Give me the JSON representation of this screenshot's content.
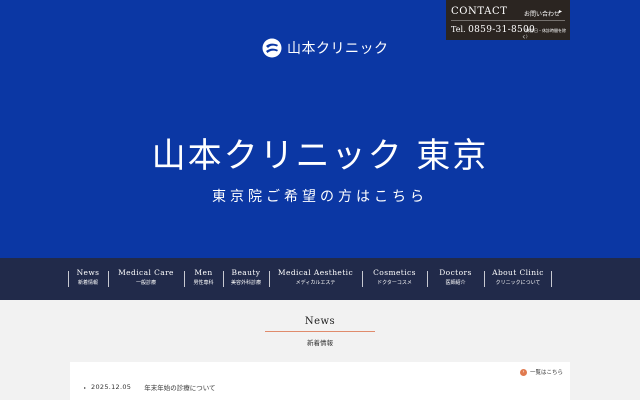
{
  "header": {
    "logo_text": "山本クリニック",
    "logo_icon": "clinic-logo-mark"
  },
  "hero": {
    "title": "山本クリニック 東京",
    "subtitle": "東京院ご希望の方はこちら"
  },
  "contact": {
    "label": "CONTACT",
    "inquiry": "お問い合わせ",
    "arrow": "▸",
    "tel_prefix": "Tel.",
    "tel_number": "0859-31-8500",
    "note": "（休診日・休診時間を除く）"
  },
  "nav": {
    "items": [
      {
        "en": "News",
        "jp": "新着情報"
      },
      {
        "en": "Medical Care",
        "jp": "一般診療"
      },
      {
        "en": "Men",
        "jp": "男性専科"
      },
      {
        "en": "Beauty",
        "jp": "美容外科診療"
      },
      {
        "en": "Medical Aesthetic",
        "jp": "メディカルエステ"
      },
      {
        "en": "Cosmetics",
        "jp": "ドクターコスメ"
      },
      {
        "en": "Doctors",
        "jp": "医師紹介"
      },
      {
        "en": "About Clinic",
        "jp": "クリニックについて"
      }
    ]
  },
  "news": {
    "title": "News",
    "subtitle": "新着情報",
    "view_all": "一覧はこちら",
    "view_all_icon": "arrow-circle-icon",
    "items": [
      {
        "date": "2025.12.05",
        "text": "年末年始の診療について"
      }
    ]
  },
  "colors": {
    "hero_bg": "#0b37a4",
    "nav_bg": "#212a4a",
    "contact_bg": "#2b2521",
    "accent": "#e07a4f"
  }
}
